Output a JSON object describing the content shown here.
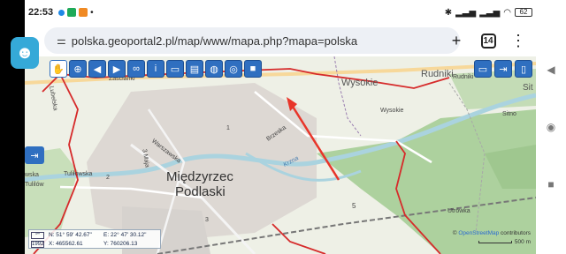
{
  "status": {
    "time": "22:53",
    "battery": "62"
  },
  "browser": {
    "url": "polska.geoportal2.pl/map/www/mapa.php?mapa=polska",
    "tab_count": "14",
    "new_tab_icon": "plus-icon",
    "menu_icon": "kebab-menu-icon"
  },
  "map": {
    "labels": {
      "city_line1": "Międzyrzec",
      "city_line2": "Podlaski",
      "wysokie_big": "Wysokie",
      "wysokie_small": "Wysokie",
      "rudniki_big": "Rudniki",
      "rudniki_small": "Rudniki",
      "zasciank": "Zaścianki",
      "sitno": "Sitno",
      "sit": "Sit",
      "utrowka": "Utrówka",
      "tuliłowska": "Tuliłowska",
      "tuliłow": "Tulilów",
      "wska": "wska",
      "brzeska": "Brzeska",
      "warszawska": "Warszawska",
      "krzna": "Krzna",
      "num5": "5",
      "num1": "1",
      "num2": "2",
      "num3": "3",
      "lubelska": "Lubelska",
      "kolejowa": "3 Maja",
      "zak": "Zak"
    },
    "coords": {
      "sys1": "°'\"",
      "sys2": "1992",
      "n": "N: 51° 59' 42.67\"",
      "e": "E: 22° 47' 30.12\"",
      "x": "X: 465562.61",
      "y": "Y: 760206.13"
    },
    "attribution_prefix": "© ",
    "attribution_link": "OpenStreetMap",
    "attribution_suffix": " contributors",
    "scale": "500 m",
    "colors": {
      "accent": "#2f6fc0",
      "boundary": "#d62b2b",
      "forest": "#add19e",
      "water": "#aad3df",
      "arrow": "#e8352a"
    }
  },
  "toolbar": {
    "tools": [
      "pan-hand-icon",
      "zoom-icon",
      "back-arrow-icon",
      "forward-arrow-icon",
      "link-icon",
      "info-icon",
      "measure-icon",
      "print-icon",
      "globe-icon",
      "target-icon",
      "video-icon"
    ],
    "right_tools": [
      "window-icon",
      "export-icon",
      "panel-icon"
    ]
  }
}
